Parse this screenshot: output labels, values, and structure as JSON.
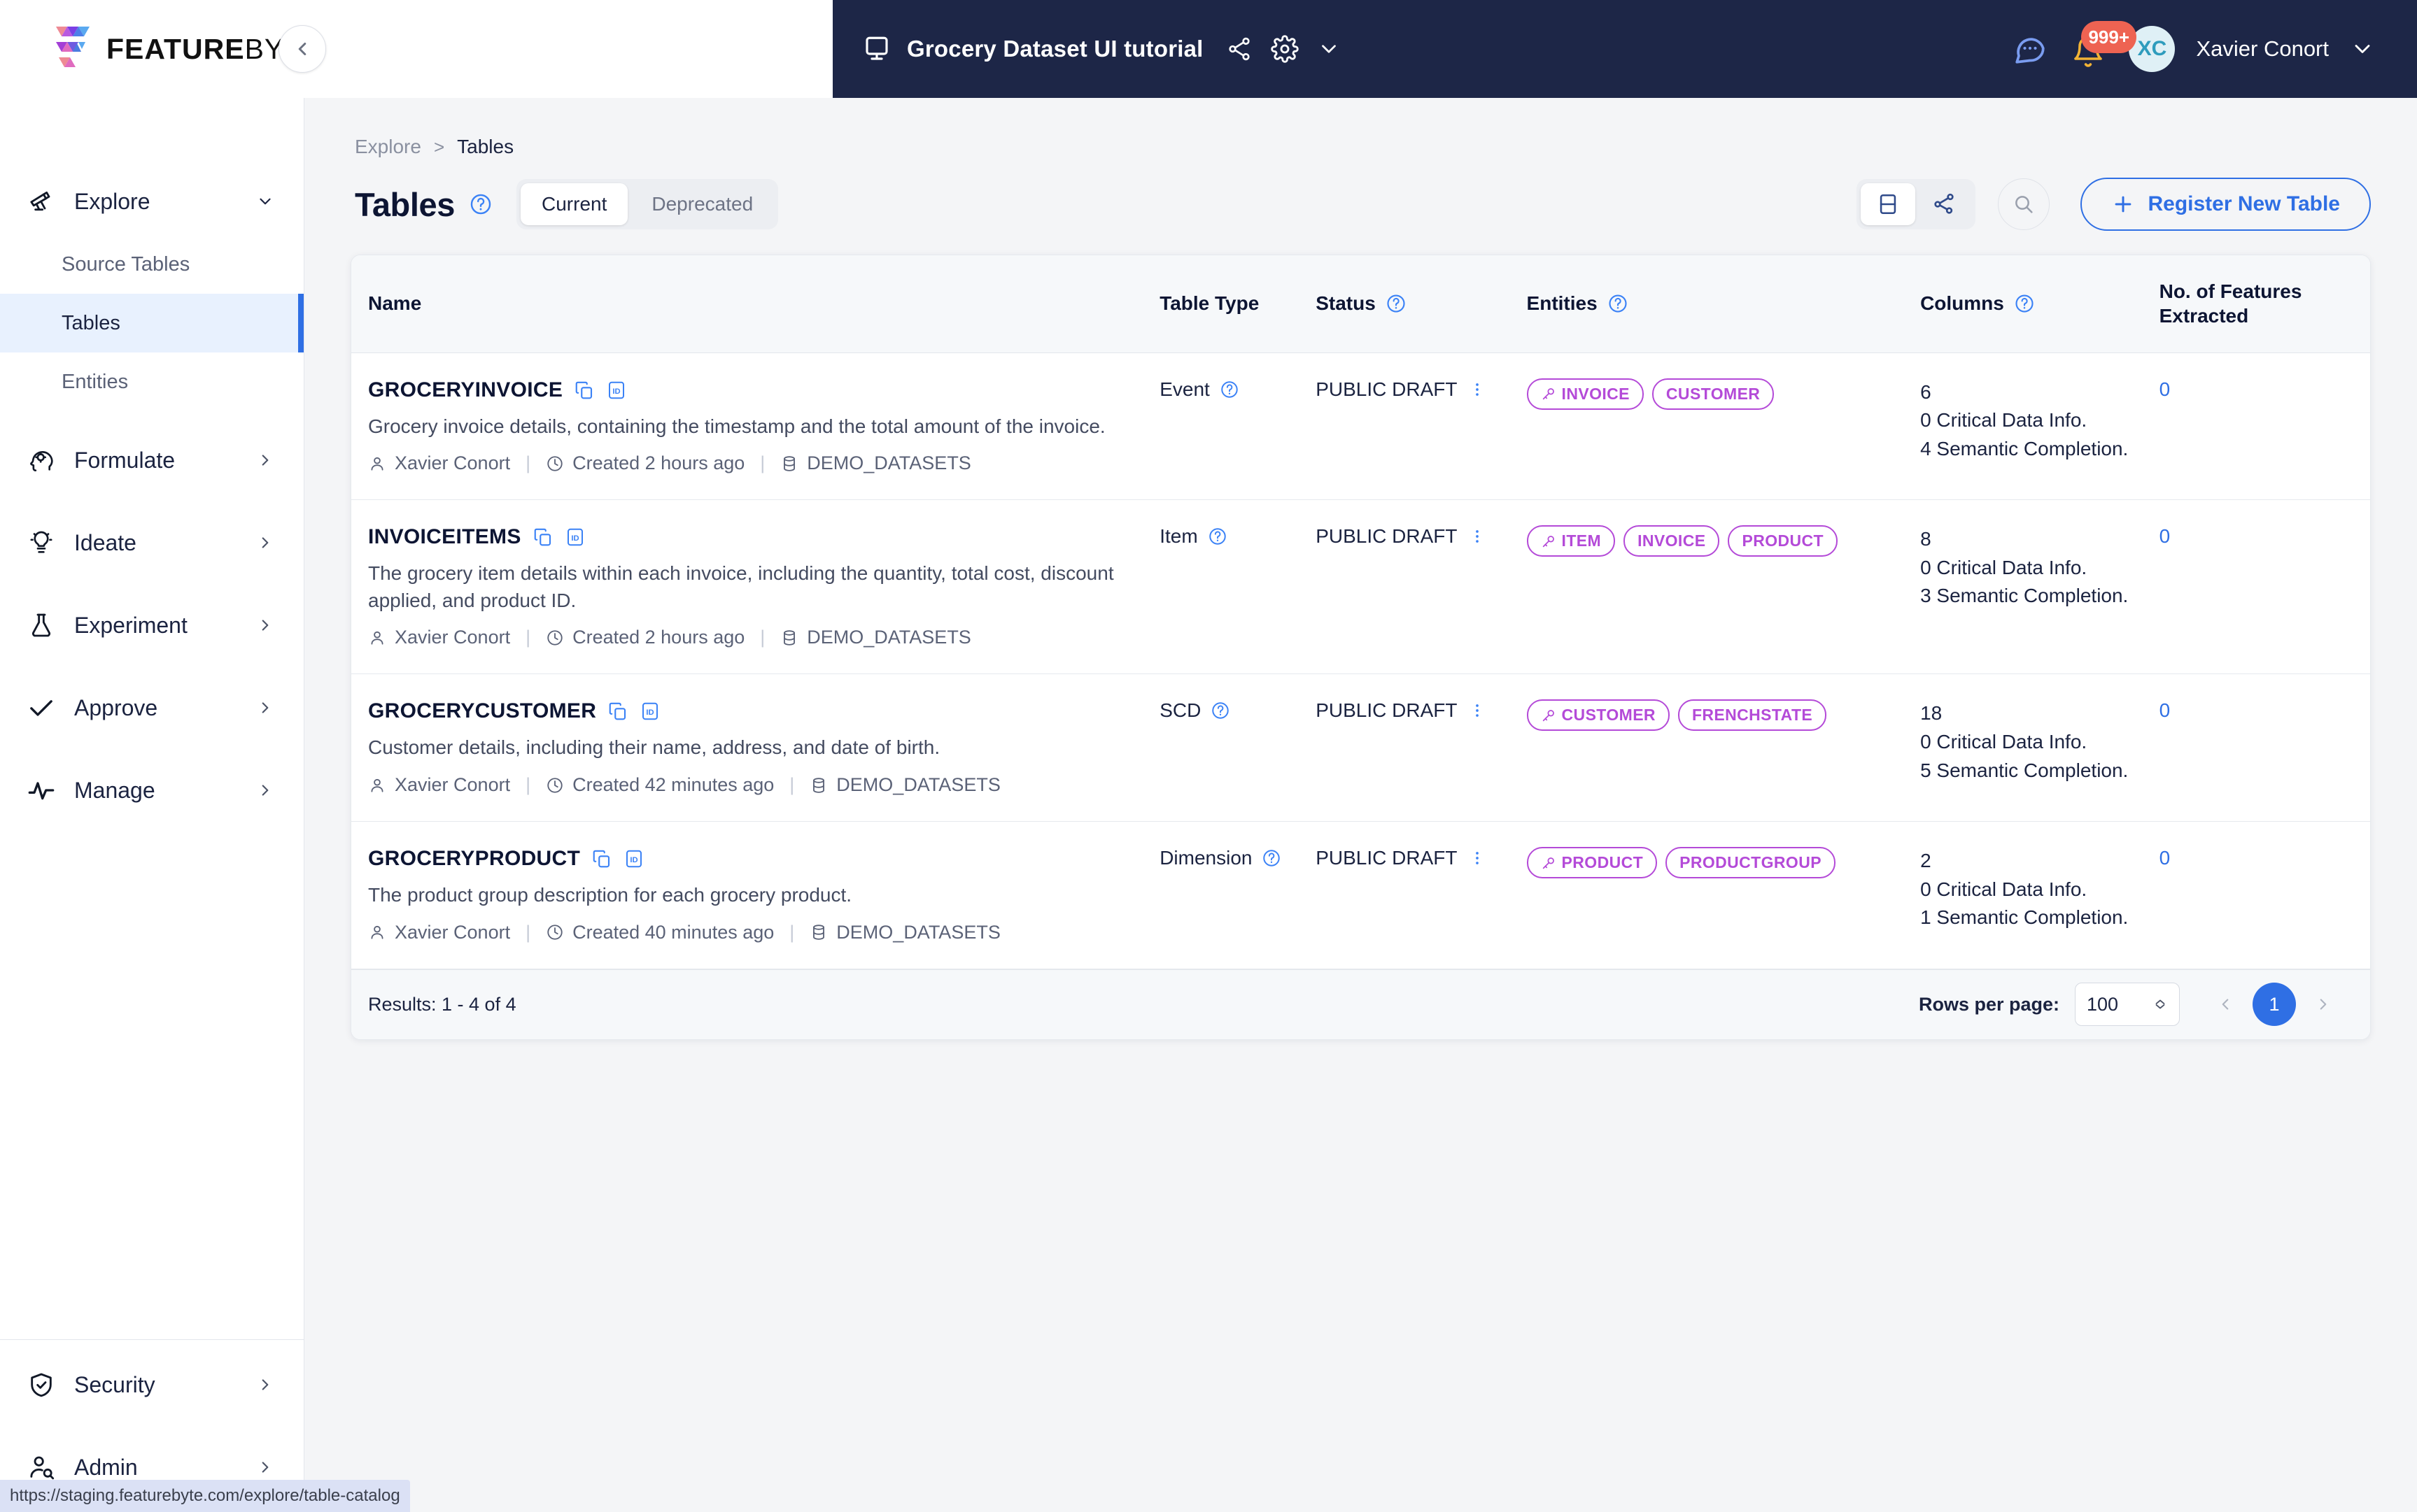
{
  "topbar": {
    "brand": {
      "text_bold": "FEATURE",
      "text_light": "BYTE",
      "logo_icon": "featurebyte-logo"
    },
    "collapse_icon": "chevron-left-icon",
    "workspace_icon": "monitor-icon",
    "workspace_name": "Grocery Dataset UI tutorial",
    "share_icon": "share-nodes-icon",
    "settings_icon": "gear-icon",
    "workspace_chevron_icon": "chevron-down-icon",
    "chat_icon": "chat-bubble-icon",
    "bell_icon": "bell-icon",
    "notification_badge": "999+",
    "avatar_initials": "XC",
    "user_name": "Xavier Conort",
    "user_chevron_icon": "chevron-down-icon"
  },
  "sidebar": {
    "groups": [
      {
        "label": "Explore",
        "icon": "telescope-icon",
        "chevron": "chevron-down-icon",
        "expanded": true
      },
      {
        "label": "Formulate",
        "icon": "head-gear-icon",
        "chevron": "chevron-right-icon",
        "expanded": false
      },
      {
        "label": "Ideate",
        "icon": "lightbulb-icon",
        "chevron": "chevron-right-icon",
        "expanded": false
      },
      {
        "label": "Experiment",
        "icon": "flask-icon",
        "chevron": "chevron-right-icon",
        "expanded": false
      },
      {
        "label": "Approve",
        "icon": "check-icon",
        "chevron": "chevron-right-icon",
        "expanded": false
      },
      {
        "label": "Manage",
        "icon": "activity-pulse-icon",
        "chevron": "chevron-right-icon",
        "expanded": false
      }
    ],
    "explore_children": [
      {
        "label": "Source Tables",
        "active": false
      },
      {
        "label": "Tables",
        "active": true
      },
      {
        "label": "Entities",
        "active": false
      }
    ],
    "bottom": [
      {
        "label": "Security",
        "icon": "shield-check-icon",
        "chevron": "chevron-right-icon"
      },
      {
        "label": "Admin",
        "icon": "user-search-icon",
        "chevron": "chevron-right-icon"
      }
    ]
  },
  "breadcrumb": {
    "parent": "Explore",
    "separator": ">",
    "current": "Tables"
  },
  "page": {
    "title": "Tables",
    "help_icon": "question-circle-icon",
    "segments": [
      {
        "label": "Current",
        "active": true
      },
      {
        "label": "Deprecated",
        "active": false
      }
    ],
    "view_toggle": [
      {
        "icon": "table-view-icon",
        "active": true
      },
      {
        "icon": "graph-view-icon",
        "active": false
      }
    ],
    "search_icon": "search-icon",
    "register_button": {
      "label": "Register New Table",
      "icon": "plus-icon"
    }
  },
  "table": {
    "columns": [
      {
        "label": "Name",
        "help": false
      },
      {
        "label": "Table Type",
        "help": false
      },
      {
        "label": "Status",
        "help": true
      },
      {
        "label": "Entities",
        "help": true
      },
      {
        "label": "Columns",
        "help": true
      },
      {
        "label": "No. of Features Extracted",
        "help": false
      }
    ],
    "row_icons": {
      "copy": "copy-icon",
      "id": "id-badge-icon",
      "user": "user-icon",
      "clock": "clock-icon",
      "database": "database-icon",
      "menu": "more-vertical-icon",
      "type_help": "question-circle-icon",
      "key": "key-icon"
    },
    "rows": [
      {
        "name": "GROCERYINVOICE",
        "description": "Grocery invoice details, containing the timestamp and the total amount of the invoice.",
        "author": "Xavier Conort",
        "created": "Created 2 hours ago",
        "source": "DEMO_DATASETS",
        "table_type": "Event",
        "status": "PUBLIC DRAFT",
        "entities": [
          {
            "label": "INVOICE",
            "primary": true
          },
          {
            "label": "CUSTOMER",
            "primary": false
          }
        ],
        "columns_count": "6",
        "critical_data": "0 Critical Data Info.",
        "semantic": "4 Semantic Completion.",
        "features_extracted": "0"
      },
      {
        "name": "INVOICEITEMS",
        "description": "The grocery item details within each invoice, including the quantity, total cost, discount applied, and product ID.",
        "author": "Xavier Conort",
        "created": "Created 2 hours ago",
        "source": "DEMO_DATASETS",
        "table_type": "Item",
        "status": "PUBLIC DRAFT",
        "entities": [
          {
            "label": "ITEM",
            "primary": true
          },
          {
            "label": "INVOICE",
            "primary": false
          },
          {
            "label": "PRODUCT",
            "primary": false
          }
        ],
        "columns_count": "8",
        "critical_data": "0 Critical Data Info.",
        "semantic": "3 Semantic Completion.",
        "features_extracted": "0"
      },
      {
        "name": "GROCERYCUSTOMER",
        "description": "Customer details, including their name, address, and date of birth.",
        "author": "Xavier Conort",
        "created": "Created 42 minutes ago",
        "source": "DEMO_DATASETS",
        "table_type": "SCD",
        "status": "PUBLIC DRAFT",
        "entities": [
          {
            "label": "CUSTOMER",
            "primary": true
          },
          {
            "label": "FRENCHSTATE",
            "primary": false
          }
        ],
        "columns_count": "18",
        "critical_data": "0 Critical Data Info.",
        "semantic": "5 Semantic Completion.",
        "features_extracted": "0"
      },
      {
        "name": "GROCERYPRODUCT",
        "description": "The product group description for each grocery product.",
        "author": "Xavier Conort",
        "created": "Created 40 minutes ago",
        "source": "DEMO_DATASETS",
        "table_type": "Dimension",
        "status": "PUBLIC DRAFT",
        "entities": [
          {
            "label": "PRODUCT",
            "primary": true
          },
          {
            "label": "PRODUCTGROUP",
            "primary": false
          }
        ],
        "columns_count": "2",
        "critical_data": "0 Critical Data Info.",
        "semantic": "1 Semantic Completion.",
        "features_extracted": "0"
      }
    ]
  },
  "footer": {
    "results": "Results: 1 - 4 of 4",
    "rows_per_page_label": "Rows per page:",
    "rows_per_page_value": "100",
    "prev_icon": "chevron-left-icon",
    "next_icon": "chevron-right-icon",
    "current_page": "1"
  },
  "statusbar": {
    "url": "https://staging.featurebyte.com/explore/table-catalog"
  },
  "colors": {
    "header_navy": "#1d2647",
    "accent_blue": "#2f6fe4",
    "entity_purple": "#b44ad8",
    "badge_red": "#ee6352",
    "avatar_bg": "#dff0f6",
    "avatar_text": "#2e9cbd",
    "bell_yellow": "#f2b335",
    "page_bg": "#f4f5f7"
  }
}
